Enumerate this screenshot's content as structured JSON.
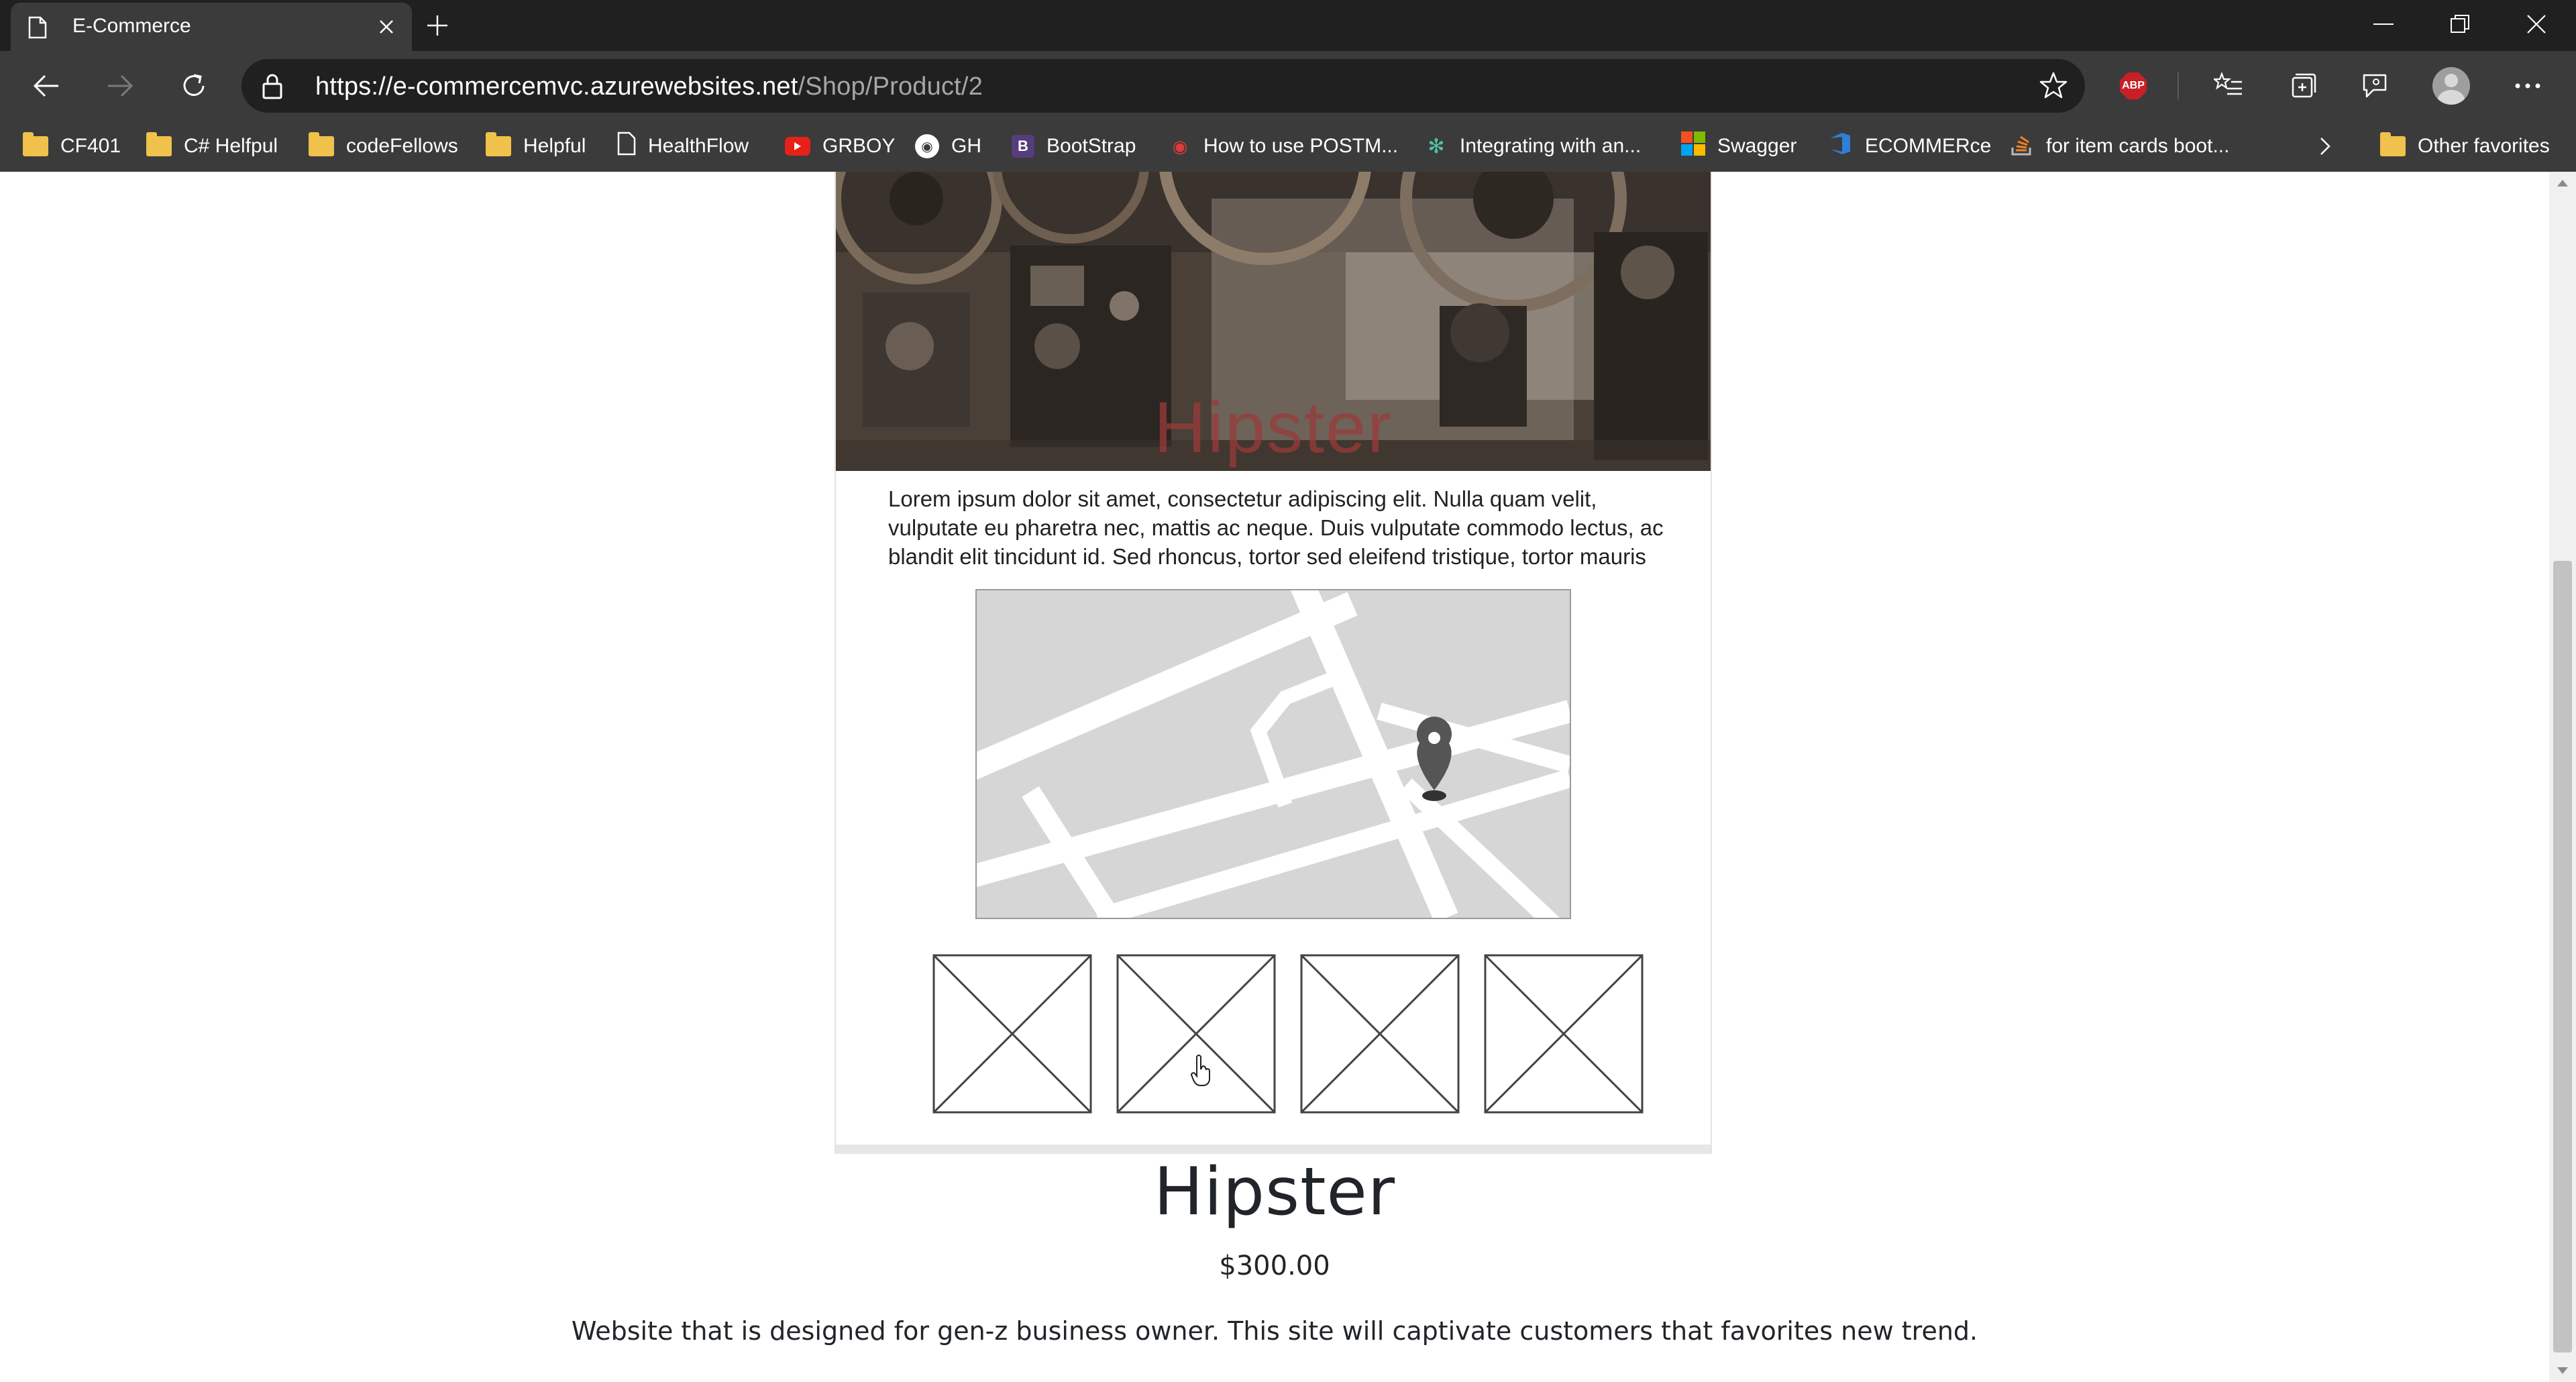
{
  "browser": {
    "tab_title": "E-Commerce",
    "url_host": "https://e-commercemvc.azurewebsites.net",
    "url_path": "/Shop/Product/2",
    "abp_label": "ABP"
  },
  "bookmarks": [
    {
      "label": "CF401",
      "icon": "folder-icon"
    },
    {
      "label": "C# Helfpul",
      "icon": "folder-icon"
    },
    {
      "label": "codeFellows",
      "icon": "folder-icon"
    },
    {
      "label": "Helpful",
      "icon": "folder-icon"
    },
    {
      "label": "HealthFlow",
      "icon": "page-icon"
    },
    {
      "label": "GRBOY",
      "icon": "youtube-icon"
    },
    {
      "label": "GH",
      "icon": "github-icon"
    },
    {
      "label": "BootStrap",
      "icon": "bootstrap-icon"
    },
    {
      "label": "How to use POSTM...",
      "icon": "postman-icon"
    },
    {
      "label": "Integrating with an...",
      "icon": "openai-icon"
    },
    {
      "label": "Swagger",
      "icon": "microsoft-icon"
    },
    {
      "label": "ECOMMERce",
      "icon": "devops-icon"
    },
    {
      "label": "for item cards boot...",
      "icon": "stackoverflow-icon"
    }
  ],
  "other_favorites": "Other favorites",
  "product_image": {
    "hero_text": "Hipster",
    "lorem": "Lorem ipsum dolor sit amet, consectetur adipiscing elit. Nulla quam velit, vulputate eu pharetra nec, mattis ac neque. Duis vulputate commodo lectus, ac blandit elit tincidunt id. Sed rhoncus, tortor sed eleifend tristique, tortor mauris"
  },
  "product": {
    "name": "Hipster",
    "price": "$300.00",
    "description": "Website that is designed for gen-z business owner. This site will captivate customers that favorites new trend."
  },
  "colors": {
    "chrome_dark": "#202020",
    "chrome": "#3b3b3b",
    "hero_text": "#9b3a3a",
    "folder": "#f0c14b"
  }
}
